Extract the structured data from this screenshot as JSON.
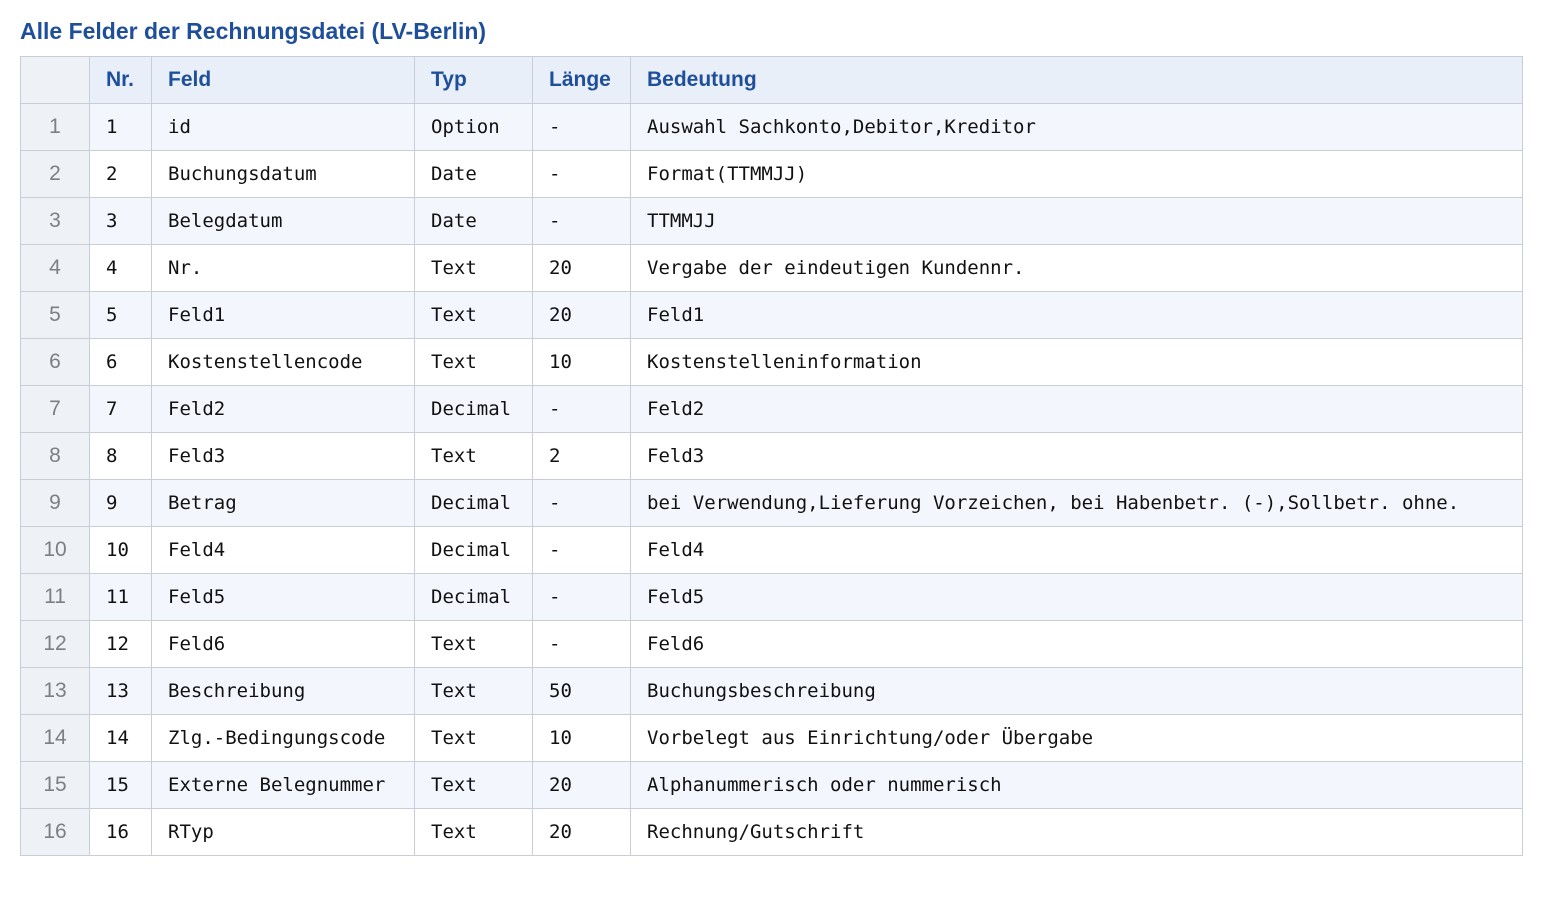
{
  "title": "Alle Felder der Rechnungsdatei (LV-Berlin)",
  "table": {
    "headers": [
      "",
      "Nr.",
      "Feld",
      "Typ",
      "Länge",
      "Bedeutung"
    ],
    "rows": [
      {
        "idx": "1",
        "nr": "1",
        "feld": "id",
        "typ": "Option",
        "laenge": "-",
        "bedeutung": "Auswahl Sachkonto,Debitor,Kreditor"
      },
      {
        "idx": "2",
        "nr": "2",
        "feld": "Buchungsdatum",
        "typ": "Date",
        "laenge": "-",
        "bedeutung": "Format(TTMMJJ)"
      },
      {
        "idx": "3",
        "nr": "3",
        "feld": "Belegdatum",
        "typ": "Date",
        "laenge": "-",
        "bedeutung": "TTMMJJ"
      },
      {
        "idx": "4",
        "nr": "4",
        "feld": "Nr.",
        "typ": "Text",
        "laenge": "20",
        "bedeutung": "Vergabe der eindeutigen Kundennr."
      },
      {
        "idx": "5",
        "nr": "5",
        "feld": "Feld1",
        "typ": "Text",
        "laenge": "20",
        "bedeutung": "Feld1"
      },
      {
        "idx": "6",
        "nr": "6",
        "feld": "Kostenstellencode",
        "typ": "Text",
        "laenge": "10",
        "bedeutung": "Kostenstelleninformation"
      },
      {
        "idx": "7",
        "nr": "7",
        "feld": "Feld2",
        "typ": "Decimal",
        "laenge": "-",
        "bedeutung": "Feld2"
      },
      {
        "idx": "8",
        "nr": "8",
        "feld": "Feld3",
        "typ": "Text",
        "laenge": "2",
        "bedeutung": "Feld3"
      },
      {
        "idx": "9",
        "nr": "9",
        "feld": "Betrag",
        "typ": "Decimal",
        "laenge": "-",
        "bedeutung": "bei Verwendung,Lieferung Vorzeichen, bei Habenbetr. (-),Sollbetr. ohne."
      },
      {
        "idx": "10",
        "nr": "10",
        "feld": "Feld4",
        "typ": "Decimal",
        "laenge": "-",
        "bedeutung": "Feld4"
      },
      {
        "idx": "11",
        "nr": "11",
        "feld": "Feld5",
        "typ": "Decimal",
        "laenge": "-",
        "bedeutung": "Feld5"
      },
      {
        "idx": "12",
        "nr": "12",
        "feld": "Feld6",
        "typ": "Text",
        "laenge": "-",
        "bedeutung": "Feld6"
      },
      {
        "idx": "13",
        "nr": "13",
        "feld": "Beschreibung",
        "typ": "Text",
        "laenge": "50",
        "bedeutung": "Buchungsbeschreibung"
      },
      {
        "idx": "14",
        "nr": "14",
        "feld": "Zlg.-Bedingungscode",
        "typ": "Text",
        "laenge": "10",
        "bedeutung": "Vorbelegt aus Einrichtung/oder Übergabe"
      },
      {
        "idx": "15",
        "nr": "15",
        "feld": "Externe Belegnummer",
        "typ": "Text",
        "laenge": "20",
        "bedeutung": "Alphanummerisch oder nummerisch"
      },
      {
        "idx": "16",
        "nr": "16",
        "feld": "RTyp",
        "typ": "Text",
        "laenge": "20",
        "bedeutung": "Rechnung/Gutschrift"
      }
    ]
  },
  "colors": {
    "title": "#1f4f9a",
    "header_bg": "#e8eff9",
    "row_alt_bg": "#f3f6fc",
    "index_bg": "#eef1f5",
    "border": "#c9ced6"
  }
}
